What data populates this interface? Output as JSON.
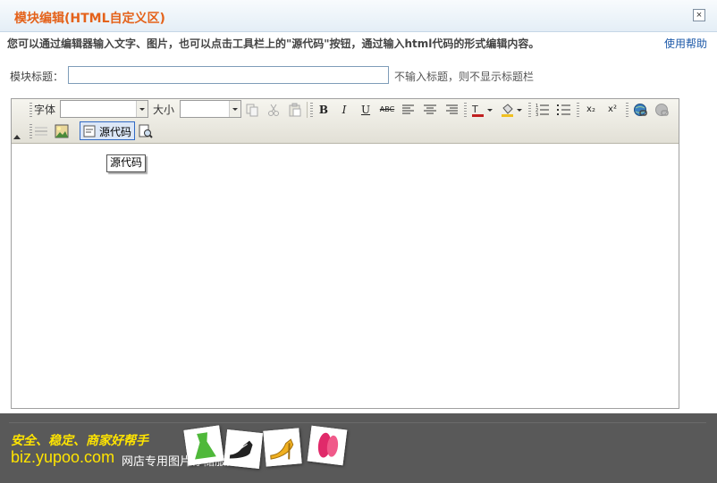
{
  "dialog": {
    "title": "模块编辑(HTML自定义区)",
    "close_glyph": "×",
    "description": "您可以通过编辑器输入文字、图片，也可以点击工具栏上的\"源代码\"按钮，通过输入html代码的形式编辑内容。",
    "help_link": "使用帮助",
    "title_field": {
      "label": "模块标题：",
      "value": "",
      "placeholder": "",
      "hint": "不输入标题，则不显示标题栏"
    }
  },
  "toolbar": {
    "font_label": "字体",
    "font_value": "",
    "size_label": "大小",
    "size_value": "",
    "bold": "B",
    "italic": "I",
    "underline": "U",
    "strike": "ABC",
    "subscript": "x₂",
    "superscript": "x²",
    "source_label": "源代码",
    "buttons": [
      "copy-icon",
      "cut-icon",
      "paste-icon",
      "bold-icon",
      "italic-icon",
      "underline-icon",
      "strikethrough-icon",
      "align-left-icon",
      "align-center-icon",
      "align-right-icon",
      "text-color-icon",
      "background-color-icon",
      "ordered-list-icon",
      "unordered-list-icon",
      "subscript-icon",
      "superscript-icon",
      "insert-link-icon",
      "unlink-icon",
      "horizontal-rule-icon",
      "insert-image-icon",
      "source-code-icon",
      "preview-icon"
    ]
  },
  "tooltip": "源代码",
  "editor_content": "",
  "footer": {
    "slogan": "安全、稳定、商家好帮手",
    "domain": "biz.yupoo.com",
    "tagline": "网店专用图片存储服务"
  },
  "colors": {
    "title": "#e4621a",
    "help_link": "#1b58a8",
    "footer_bg": "#595959",
    "footer_accent": "#ffe400"
  }
}
